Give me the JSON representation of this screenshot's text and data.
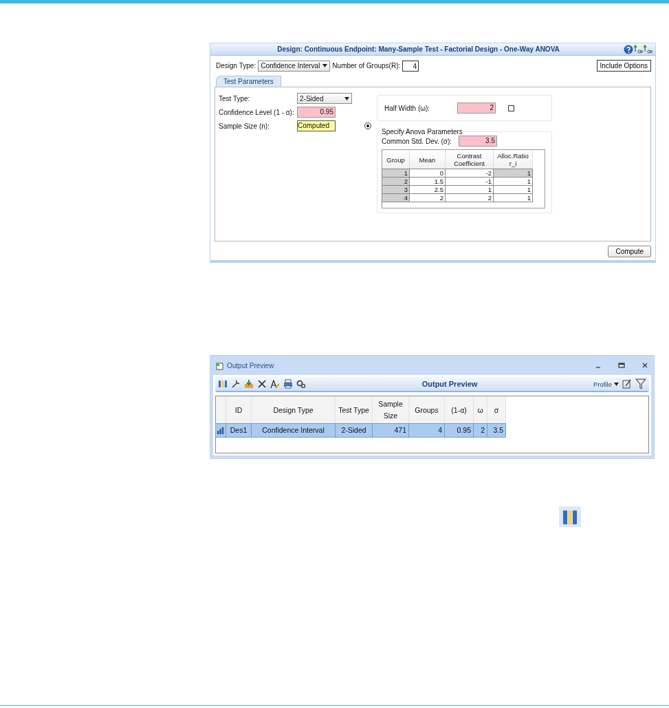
{
  "design_window": {
    "title": "Design: Continuous Endpoint: Many-Sample Test - Factorial Design - One-Way ANOVA",
    "design_type": {
      "label": "Design Type:",
      "value": "Confidence Interval"
    },
    "number_of_groups": {
      "label": "Number of Groups(R):",
      "value": "4"
    },
    "include_options": "Include Options",
    "tabs": [
      {
        "label": "Test Parameters",
        "selected": true
      }
    ],
    "test_type": {
      "label": "Test Type:",
      "value": "2-Sided"
    },
    "confidence_level": {
      "label": "Confidence Level (1 - α):",
      "value": "0.95"
    },
    "sample_size": {
      "label": "Sample Size (n):",
      "value": "Computed",
      "selected": true
    },
    "half_width": {
      "label": "Half Width (ω):",
      "value": "2",
      "checked": false
    },
    "anova": {
      "legend": "Specify Anova Parameters",
      "std_dev": {
        "label": "Common Std. Dev. (σ):",
        "value": "3.5"
      },
      "columns": [
        "Group",
        "Mean",
        "Contrast Coefficient",
        "Alloc.Ratio r_i"
      ],
      "rows": [
        [
          "1",
          "0",
          "-2",
          "1"
        ],
        [
          "2",
          "1.5",
          "-1",
          "1"
        ],
        [
          "3",
          "2.5",
          "1",
          "1"
        ],
        [
          "4",
          "2",
          "2",
          "1"
        ]
      ]
    },
    "compute": "Compute"
  },
  "output_window": {
    "title": "Output Preview",
    "toolbar_title": "Output Preview",
    "profile": "Profile",
    "columns": [
      "ID",
      "Design Type",
      "Test Type",
      "Sample Size",
      "Groups",
      "(1-α)",
      "ω",
      "σ"
    ],
    "rows": [
      {
        "selected": true,
        "cells": [
          "Des1",
          "Confidence Interval",
          "2-Sided",
          "471",
          "4",
          "0.95",
          "2",
          "3.5"
        ]
      }
    ]
  }
}
